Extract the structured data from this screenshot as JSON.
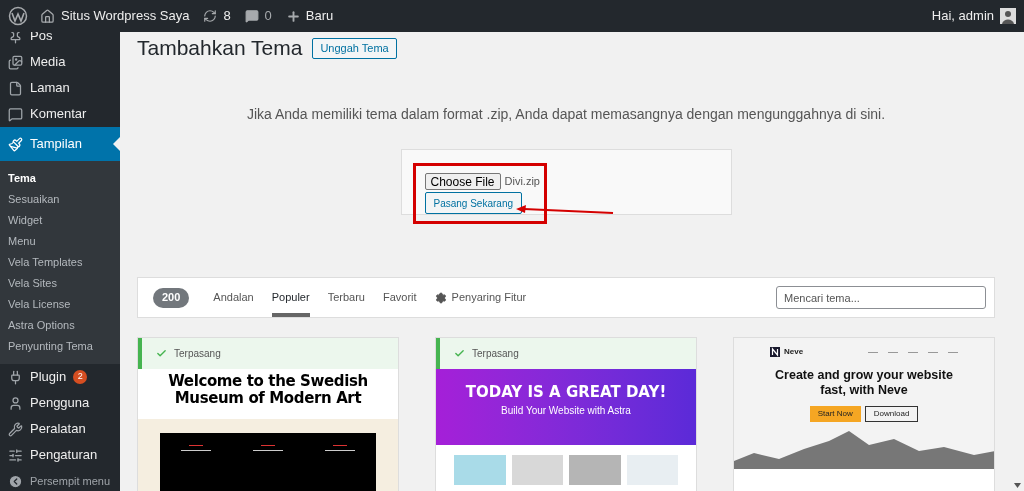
{
  "admin_bar": {
    "site_name": "Situs Wordpress Saya",
    "updates": "8",
    "comments": "0",
    "new_label": "Baru",
    "greeting": "Hai, admin"
  },
  "sidebar": {
    "items": [
      {
        "label": "Pos",
        "selected": false
      },
      {
        "label": "Media",
        "selected": false
      },
      {
        "label": "Laman",
        "selected": false
      },
      {
        "label": "Komentar",
        "selected": false
      },
      {
        "label": "Tampilan",
        "selected": true,
        "children": [
          {
            "label": "Tema",
            "selected": true
          },
          {
            "label": "Sesuaikan",
            "selected": false
          },
          {
            "label": "Widget",
            "selected": false
          },
          {
            "label": "Menu",
            "selected": false
          },
          {
            "label": "Vela Templates",
            "selected": false
          },
          {
            "label": "Vela Sites",
            "selected": false
          },
          {
            "label": "Vela License",
            "selected": false
          },
          {
            "label": "Astra Options",
            "selected": false
          },
          {
            "label": "Penyunting Tema",
            "selected": false
          }
        ]
      },
      {
        "label": "Plugin",
        "selected": false,
        "badge": "2"
      },
      {
        "label": "Pengguna",
        "selected": false
      },
      {
        "label": "Peralatan",
        "selected": false
      },
      {
        "label": "Pengaturan",
        "selected": false
      }
    ],
    "collapse_label": "Persempit menu"
  },
  "page": {
    "title": "Tambahkan Tema",
    "upload_button": "Unggah Tema",
    "description": "Jika Anda memiliki tema dalam format .zip, Anda dapat memasangnya dengan mengunggahnya di sini.",
    "upload_form": {
      "choose_file": "Choose File",
      "file_name": "Divi.zip",
      "install_button": "Pasang Sekarang"
    }
  },
  "filter_bar": {
    "count": "200",
    "tabs": [
      {
        "label": "Andalan",
        "selected": false
      },
      {
        "label": "Populer",
        "selected": true
      },
      {
        "label": "Terbaru",
        "selected": false
      },
      {
        "label": "Favorit",
        "selected": false
      }
    ],
    "feature_filter": "Penyaring Fitur",
    "search": {
      "placeholder": "Mencari tema..."
    }
  },
  "themes": [
    {
      "kind": "museum",
      "installed": true,
      "status": "Terpasang",
      "headline": "Welcome to the Swedish Museum of Modern Art"
    },
    {
      "kind": "astra",
      "installed": true,
      "status": "Terpasang",
      "headline": "TODAY IS A GREAT DAY!",
      "subheadline": "Build Your Website with Astra"
    },
    {
      "kind": "neve",
      "installed": false,
      "brand": "Neve",
      "headline": "Create and grow your website fast, with Neve",
      "primary_button": "Start Now",
      "secondary_button": "Download"
    }
  ]
}
